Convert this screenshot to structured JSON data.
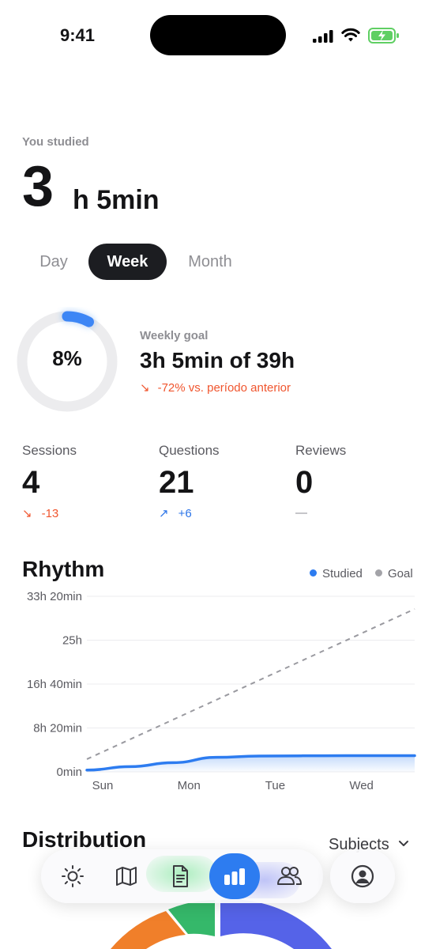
{
  "status_bar": {
    "time": "9:41"
  },
  "summary": {
    "label": "You studied",
    "hours_number": "3",
    "rest": "h 5min"
  },
  "period_tabs": [
    {
      "label": "Day",
      "active": false
    },
    {
      "label": "Week",
      "active": true
    },
    {
      "label": "Month",
      "active": false
    }
  ],
  "weekly_goal": {
    "label": "Weekly goal",
    "percent_text": "8%",
    "progress": 0.08,
    "value": "3h 5min of 39h",
    "delta_arrow": "↘",
    "delta": "-72% vs. período anterior"
  },
  "stats": [
    {
      "label": "Sessions",
      "value": "4",
      "arrow": "↘",
      "delta": "-13"
    },
    {
      "label": "Questions",
      "value": "21",
      "arrow": "↗",
      "delta": "+6"
    },
    {
      "label": "Reviews",
      "value": "0",
      "arrow": "",
      "delta": "—"
    }
  ],
  "rhythm": {
    "title": "Rhythm",
    "legend": [
      {
        "label": "Studied",
        "color": "#2d7cf0"
      },
      {
        "label": "Goal",
        "color": "#a3a3a8"
      }
    ]
  },
  "chart_data": {
    "type": "line",
    "y_ticks": [
      "33h 20min",
      "25h",
      "16h 40min",
      "8h 20min",
      "0min"
    ],
    "y_tick_values": [
      2000,
      1500,
      1000,
      500,
      0
    ],
    "ylim": [
      0,
      2000
    ],
    "x_ticks": [
      "Sun",
      "Mon",
      "Tue",
      "Wed"
    ],
    "x": [
      0,
      0.5,
      1,
      1.5,
      2,
      2.5,
      3,
      3.5,
      3.8
    ],
    "series": [
      {
        "name": "Studied",
        "color": "#2d7cf0",
        "style": "solid-area",
        "values": [
          20,
          60,
          105,
          165,
          180,
          183,
          185,
          185,
          185
        ]
      },
      {
        "name": "Goal",
        "color": "#9a9aa0",
        "style": "dashed",
        "values": [
          145,
          370,
          595,
          820,
          1045,
          1270,
          1495,
          1720,
          1855
        ]
      }
    ],
    "grid": true
  },
  "distribution": {
    "title": "Distribution",
    "filter": "Subjects",
    "filter_icon": "chevron-down-icon"
  },
  "tab_bar": {
    "items": [
      {
        "icon": "sun-icon",
        "active": false
      },
      {
        "icon": "map-icon",
        "active": false
      },
      {
        "icon": "document-icon",
        "active": false
      },
      {
        "icon": "bar-chart-icon",
        "active": true
      },
      {
        "icon": "people-icon",
        "active": false
      }
    ],
    "profile_icon": "profile-icon"
  }
}
